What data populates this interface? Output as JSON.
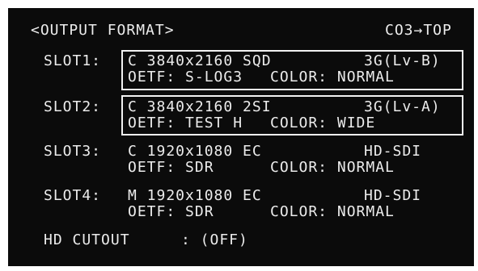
{
  "header": {
    "title": "<OUTPUT FORMAT>",
    "nav": "CO3→TOP"
  },
  "slots": [
    {
      "label": "SLOT1:",
      "line1": "C 3840x2160 SQD",
      "signal": "3G(Lv-B)",
      "oetf": "OETF: S-LOG3",
      "color": "COLOR: NORMAL",
      "selected": true
    },
    {
      "label": "SLOT2:",
      "line1": "C 3840x2160 2SI",
      "signal": "3G(Lv-A)",
      "oetf": "OETF: TEST H",
      "color": "COLOR: WIDE",
      "selected": true
    },
    {
      "label": "SLOT3:",
      "line1": "C 1920x1080 EC",
      "signal": "HD-SDI",
      "oetf": "OETF: SDR",
      "color": "COLOR: NORMAL",
      "selected": false
    },
    {
      "label": "SLOT4:",
      "line1": "M 1920x1080 EC",
      "signal": "HD-SDI",
      "oetf": "OETF: SDR",
      "color": "COLOR: NORMAL",
      "selected": false
    }
  ],
  "hd_cutout": {
    "label": "HD CUTOUT",
    "value": ": (OFF)"
  }
}
